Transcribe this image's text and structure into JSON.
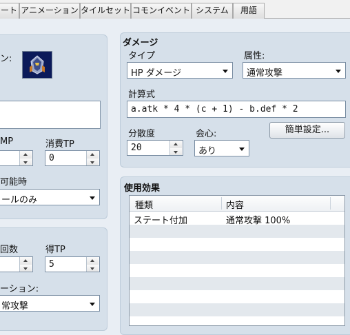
{
  "tabs": [
    "ート",
    "アニメーション",
    "タイルセット",
    "コモンイベント",
    "システム",
    "用語"
  ],
  "left_panel": {
    "icon_label": "ン:",
    "mp_label": "MP",
    "tp_cost_label": "消費TP",
    "tp_cost_value": "0",
    "occasion_label": "可能時",
    "occasion_value": "ールのみ"
  },
  "left_panel2": {
    "repeat_label": "回数",
    "tp_gain_label": "得TP",
    "tp_gain_value": "5",
    "animation_label": "ーション:",
    "animation_value": "常攻撃"
  },
  "damage": {
    "title": "ダメージ",
    "type_label": "タイプ",
    "type_value": "HP ダメージ",
    "element_label": "属性:",
    "element_value": "通常攻撃",
    "formula_label": "計算式",
    "formula_value": "a.atk * 4 * (c + 1) - b.def * 2",
    "variance_label": "分散度",
    "variance_value": "20",
    "critical_label": "会心:",
    "critical_value": "あり",
    "quick_button": "簡単設定..."
  },
  "effects": {
    "title": "使用効果",
    "columns": [
      "種類",
      "内容"
    ],
    "rows": [
      {
        "type": "ステート付加",
        "content": "通常攻撃 100%"
      }
    ]
  },
  "icons": {
    "skill_icon": "armored-helmet-icon"
  }
}
